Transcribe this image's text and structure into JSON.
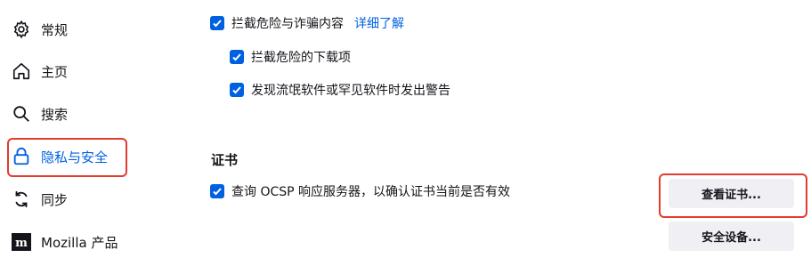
{
  "sidebar": {
    "items": [
      {
        "label": "常规",
        "icon": "gear-icon"
      },
      {
        "label": "主页",
        "icon": "home-icon"
      },
      {
        "label": "搜索",
        "icon": "search-icon"
      },
      {
        "label": "隐私与安全",
        "icon": "lock-icon"
      },
      {
        "label": "同步",
        "icon": "sync-icon"
      },
      {
        "label": "Mozilla 产品",
        "icon": "mozilla-icon"
      }
    ],
    "selected": "隐私与安全"
  },
  "security": {
    "block_dangerous": {
      "label": "拦截危险与诈骗内容",
      "checked": true,
      "link": "详细了解"
    },
    "block_downloads": {
      "label": "拦截危险的下载项",
      "checked": true
    },
    "warn_unwanted": {
      "label": "发现流氓软件或罕见软件时发出警告",
      "checked": true
    }
  },
  "certificates": {
    "title": "证书",
    "ocsp": {
      "label": "查询 OCSP 响应服务器，以确认证书当前是否有效",
      "checked": true
    },
    "view_button": "查看证书...",
    "devices_button": "安全设备..."
  },
  "colors": {
    "accent": "#0061e0",
    "highlight": "#e33b2e"
  }
}
